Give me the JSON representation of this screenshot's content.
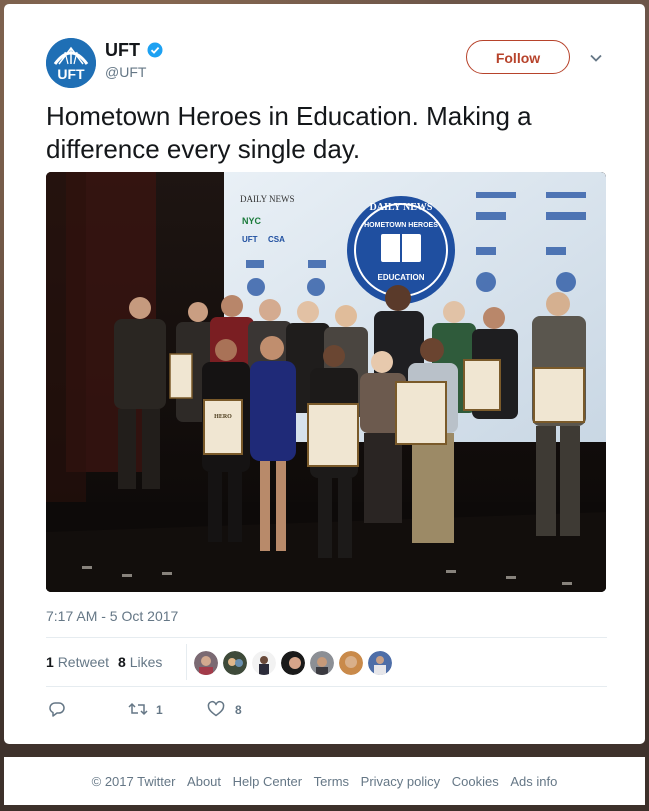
{
  "tweet": {
    "display_name": "UFT",
    "handle": "@UFT",
    "avatar_text": "UFT",
    "follow_label": "Follow",
    "text": "Hometown Heroes in Education. Making a difference every single day.",
    "timestamp": "7:17 AM - 5 Oct 2017"
  },
  "stats": {
    "retweets_count": "1",
    "retweets_label": "Retweet",
    "likes_count": "8",
    "likes_label": "Likes"
  },
  "actions": {
    "retweet_count": "1",
    "like_count": "8"
  },
  "photo": {
    "banner": {
      "brand": "DAILY NEWS",
      "badge_top": "DAILY NEWS",
      "badge_middle": "HOMETOWN HEROES",
      "badge_bottom": "EDUCATION",
      "sponsor_nyc": "NYC",
      "sponsor_uft": "UFT",
      "sponsor_csa": "CSA"
    },
    "certificate_label": "HERO"
  },
  "footer": {
    "copyright": "© 2017 Twitter",
    "links": [
      "About",
      "Help Center",
      "Terms",
      "Privacy policy",
      "Cookies",
      "Ads info"
    ]
  },
  "colors": {
    "follow_accent": "#b7432b",
    "verified_blue": "#1da1f2",
    "avatar_blue": "#1f6fb5",
    "like_accent": "#e0245e"
  },
  "icons": [
    "verified-badge-icon",
    "chevron-down-icon",
    "reply-icon",
    "retweet-icon",
    "heart-icon"
  ]
}
